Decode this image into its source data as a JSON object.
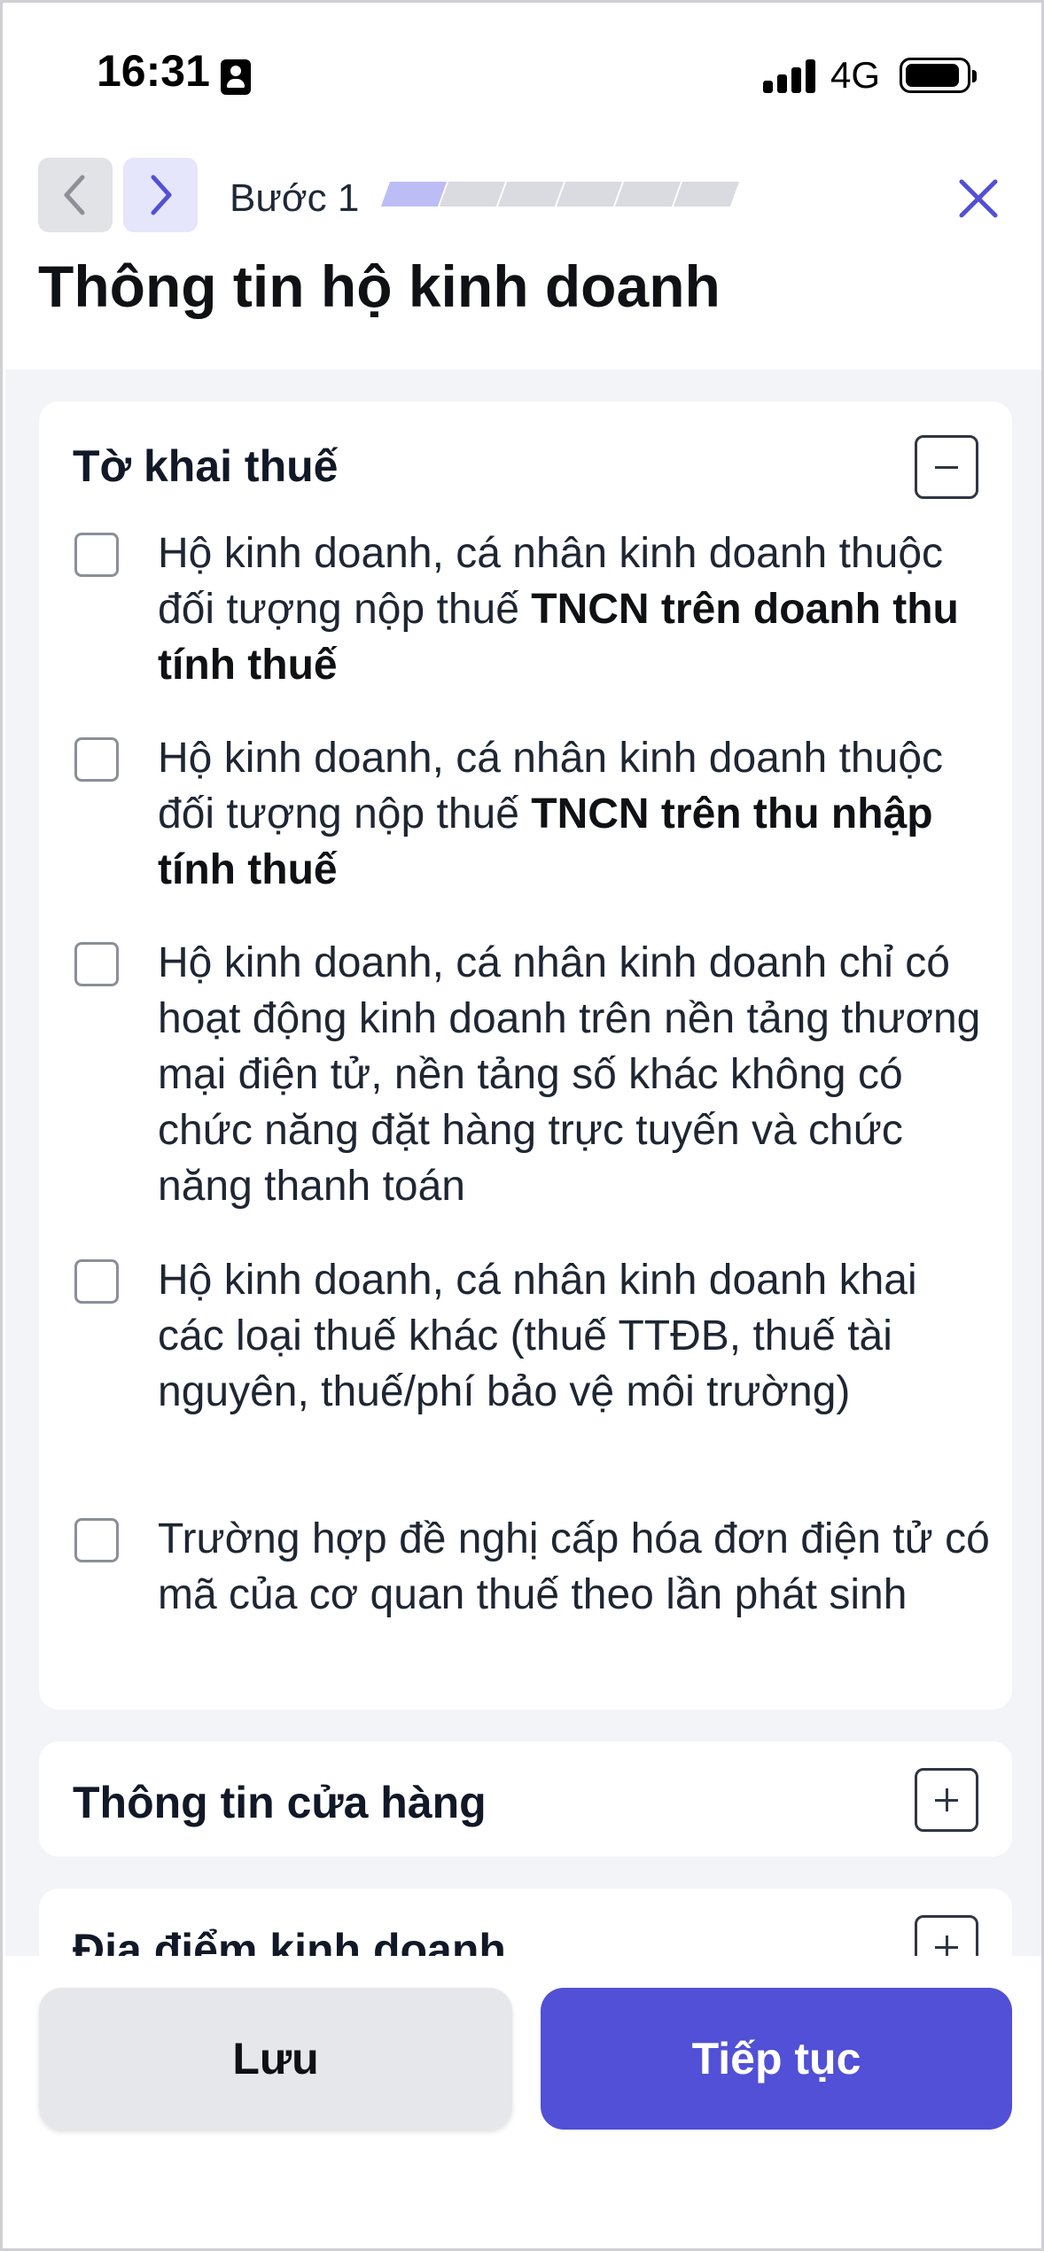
{
  "status_bar": {
    "time": "16:31",
    "network": "4G",
    "icons": [
      "contact-card-icon",
      "signal-icon",
      "battery-icon"
    ]
  },
  "header": {
    "step_label": "Bước 1",
    "step_current": 1,
    "step_total": 6,
    "title": "Thông tin hộ kinh doanh",
    "icons": [
      "chevron-left-icon",
      "chevron-right-icon",
      "close-icon"
    ]
  },
  "sections": {
    "tax_declaration": {
      "title": "Tờ khai thuế",
      "expanded": true,
      "options": [
        {
          "text": "Hộ kinh doanh, cá nhân kinh doanh thuộc đối tượng nộp thuế ",
          "bold": "TNCN trên doanh thu tính thuế",
          "checked": false
        },
        {
          "text": "Hộ kinh doanh, cá nhân kinh doanh thuộc đối tượng nộp thuế ",
          "bold": "TNCN trên thu nhập tính thuế",
          "checked": false
        },
        {
          "text": "Hộ kinh doanh, cá nhân kinh doanh chỉ có hoạt động kinh doanh trên nền tảng thương mại điện tử, nền tảng số khác không có chức năng đặt hàng trực tuyến và chức năng thanh toán",
          "bold": "",
          "checked": false
        },
        {
          "text": "Hộ kinh doanh, cá nhân kinh doanh khai các loại thuế khác (thuế TTĐB, thuế tài nguyên, thuế/phí bảo vệ môi trường)",
          "bold": "",
          "checked": false
        },
        {
          "text": "Trường hợp đề nghị cấp hóa đơn điện tử có mã của cơ quan thuế theo lần phát sinh",
          "bold": "",
          "checked": false
        }
      ]
    },
    "store_info": {
      "title": "Thông tin cửa hàng",
      "expanded": false
    },
    "business_location": {
      "title": "Địa điểm kinh doanh",
      "expanded": false
    }
  },
  "footer": {
    "save_label": "Lưu",
    "continue_label": "Tiếp tục"
  },
  "colors": {
    "accent": "#5150d6",
    "accent_light": "#e5e6fb",
    "progress_active": "#bcbdf5",
    "progress_inactive": "#dadbe0",
    "background": "#f3f4f8"
  }
}
